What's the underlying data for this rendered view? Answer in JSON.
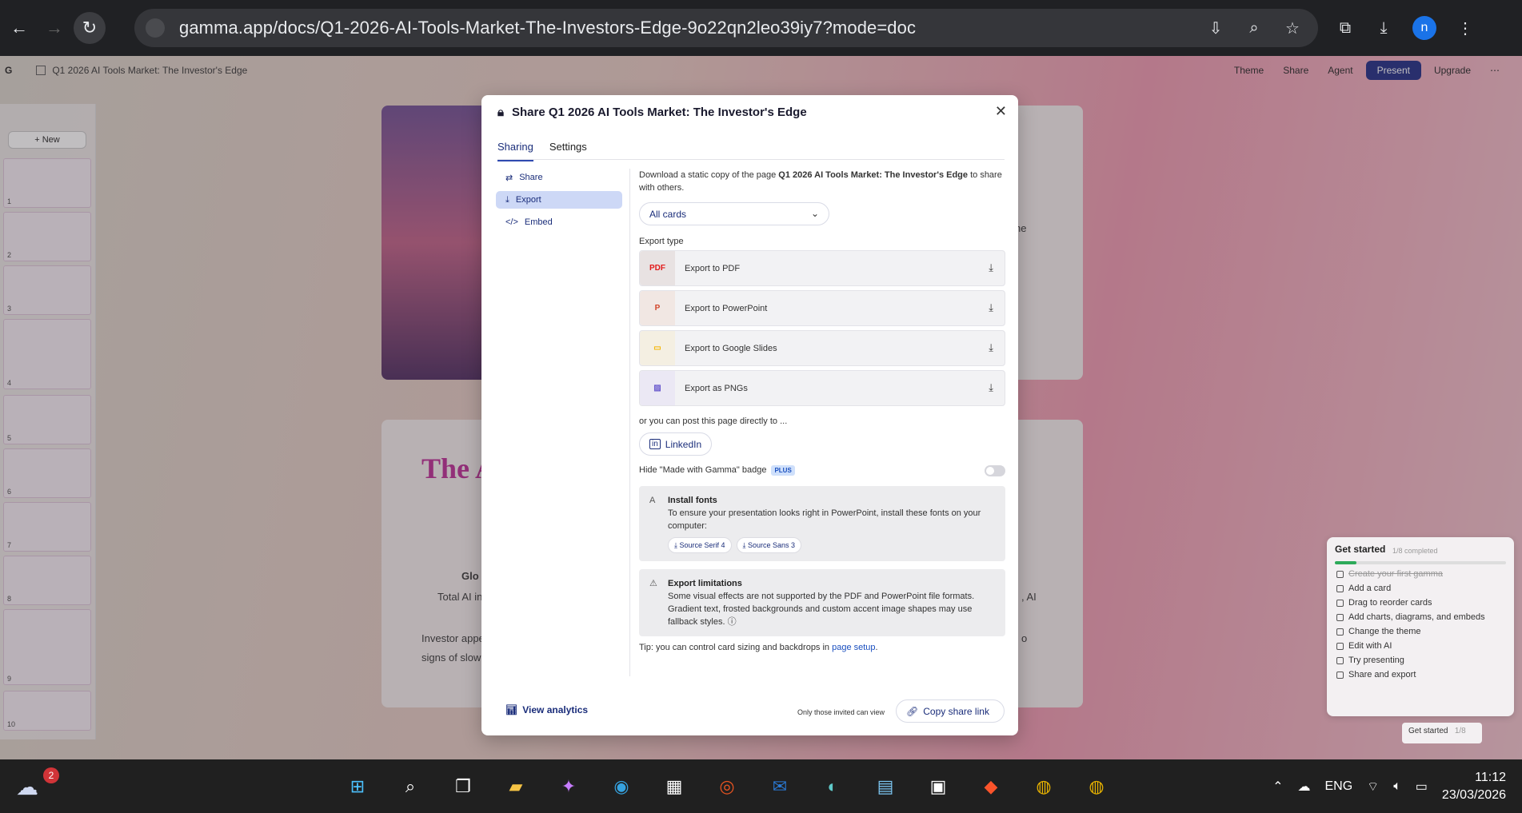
{
  "browser": {
    "url": "gamma.app/docs/Q1-2026-AI-Tools-Market-The-Investors-Edge-9o22qn2leo39iy7?mode=doc",
    "profile_initial": "n"
  },
  "app": {
    "doc_title": "Q1 2026 AI Tools Market: The Investor's Edge",
    "top_actions": [
      "Theme",
      "Share",
      "Agent",
      "Present",
      "Upgrade"
    ],
    "new_button": "New",
    "slide_numbers": [
      "1",
      "2",
      "3",
      "4",
      "5",
      "6",
      "7",
      "8",
      "9",
      "10"
    ],
    "bg_title": "The A",
    "bg_line1": "Glo",
    "bg_line2": "Total AI in",
    "bg_line3": "Investor appe",
    "bg_line4": "signs of slowi",
    "bg_right1": "he",
    "bg_right2": ", AI",
    "bg_right3": "o"
  },
  "modal": {
    "title": "Share Q1 2026 AI Tools Market: The Investor's Edge",
    "tabs": [
      "Sharing",
      "Settings"
    ],
    "nav": [
      "Share",
      "Export",
      "Embed"
    ],
    "desc_prefix": "Download a static copy of the page ",
    "desc_bold": "Q1 2026 AI Tools Market: The Investor's Edge",
    "desc_suffix": " to share with others.",
    "select_value": "All cards",
    "export_type_label": "Export type",
    "export_options": [
      {
        "label": "Export to PDF",
        "icon": "pdf-icon",
        "color": "#e8e2e2"
      },
      {
        "label": "Export to PowerPoint",
        "icon": "powerpoint-icon",
        "color": "#f1e7e3"
      },
      {
        "label": "Export to Google Slides",
        "icon": "google-slides-icon",
        "color": "#f4efe2"
      },
      {
        "label": "Export as PNGs",
        "icon": "image-icon",
        "color": "#ebe8f4"
      }
    ],
    "or_text": "or you can post this page directly to ...",
    "linkedin": "LinkedIn",
    "hide_badge": "Hide \"Made with Gamma\" badge",
    "plus": "PLUS",
    "fonts_title": "Install fonts",
    "fonts_desc": "To ensure your presentation looks right in PowerPoint, install these fonts on your computer:",
    "fonts": [
      "Source Serif 4",
      "Source Sans 3"
    ],
    "limits_title": "Export limitations",
    "limits_desc": "Some visual effects are not supported by the PDF and PowerPoint file formats. Gradient text, frosted backgrounds and custom accent image shapes may use fallback styles.",
    "tip_prefix": "Tip: you can control card sizing and backdrops in ",
    "tip_link": "page setup",
    "tip_suffix": ".",
    "view_analytics": "View analytics",
    "only_invited": "Only those invited can view",
    "copy_link": "Copy share link"
  },
  "getstarted": {
    "title": "Get started",
    "progress_text": "1/8 completed",
    "progress": 0.125,
    "items": [
      {
        "label": "Create your first gamma",
        "done": true
      },
      {
        "label": "Add a card",
        "done": false
      },
      {
        "label": "Drag to reorder cards",
        "done": false
      },
      {
        "label": "Add charts, diagrams, and embeds",
        "done": false
      },
      {
        "label": "Change the theme",
        "done": false
      },
      {
        "label": "Edit with AI",
        "done": false
      },
      {
        "label": "Try presenting",
        "done": false
      },
      {
        "label": "Share and export",
        "done": false
      }
    ],
    "mini_label": "Get started",
    "mini_count": "1/8"
  },
  "taskbar": {
    "weather_badge": "2",
    "language": "ENG",
    "time": "11:12",
    "date": "23/03/2026"
  }
}
